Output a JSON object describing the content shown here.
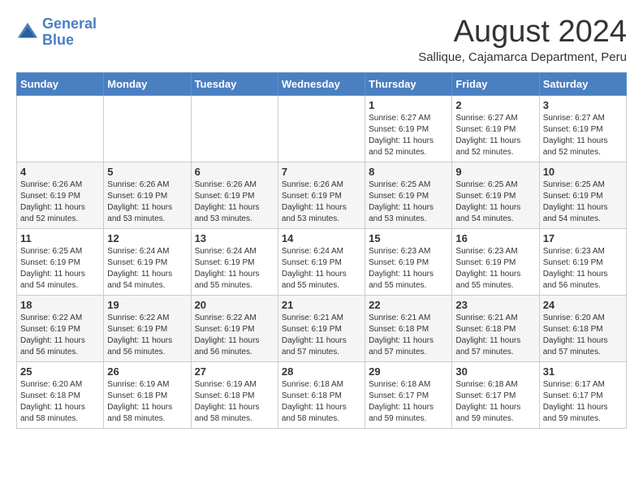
{
  "header": {
    "logo_line1": "General",
    "logo_line2": "Blue",
    "month_year": "August 2024",
    "location": "Sallique, Cajamarca Department, Peru"
  },
  "days_of_week": [
    "Sunday",
    "Monday",
    "Tuesday",
    "Wednesday",
    "Thursday",
    "Friday",
    "Saturday"
  ],
  "weeks": [
    [
      {
        "day": "",
        "info": ""
      },
      {
        "day": "",
        "info": ""
      },
      {
        "day": "",
        "info": ""
      },
      {
        "day": "",
        "info": ""
      },
      {
        "day": "1",
        "info": "Sunrise: 6:27 AM\nSunset: 6:19 PM\nDaylight: 11 hours\nand 52 minutes."
      },
      {
        "day": "2",
        "info": "Sunrise: 6:27 AM\nSunset: 6:19 PM\nDaylight: 11 hours\nand 52 minutes."
      },
      {
        "day": "3",
        "info": "Sunrise: 6:27 AM\nSunset: 6:19 PM\nDaylight: 11 hours\nand 52 minutes."
      }
    ],
    [
      {
        "day": "4",
        "info": "Sunrise: 6:26 AM\nSunset: 6:19 PM\nDaylight: 11 hours\nand 52 minutes."
      },
      {
        "day": "5",
        "info": "Sunrise: 6:26 AM\nSunset: 6:19 PM\nDaylight: 11 hours\nand 53 minutes."
      },
      {
        "day": "6",
        "info": "Sunrise: 6:26 AM\nSunset: 6:19 PM\nDaylight: 11 hours\nand 53 minutes."
      },
      {
        "day": "7",
        "info": "Sunrise: 6:26 AM\nSunset: 6:19 PM\nDaylight: 11 hours\nand 53 minutes."
      },
      {
        "day": "8",
        "info": "Sunrise: 6:25 AM\nSunset: 6:19 PM\nDaylight: 11 hours\nand 53 minutes."
      },
      {
        "day": "9",
        "info": "Sunrise: 6:25 AM\nSunset: 6:19 PM\nDaylight: 11 hours\nand 54 minutes."
      },
      {
        "day": "10",
        "info": "Sunrise: 6:25 AM\nSunset: 6:19 PM\nDaylight: 11 hours\nand 54 minutes."
      }
    ],
    [
      {
        "day": "11",
        "info": "Sunrise: 6:25 AM\nSunset: 6:19 PM\nDaylight: 11 hours\nand 54 minutes."
      },
      {
        "day": "12",
        "info": "Sunrise: 6:24 AM\nSunset: 6:19 PM\nDaylight: 11 hours\nand 54 minutes."
      },
      {
        "day": "13",
        "info": "Sunrise: 6:24 AM\nSunset: 6:19 PM\nDaylight: 11 hours\nand 55 minutes."
      },
      {
        "day": "14",
        "info": "Sunrise: 6:24 AM\nSunset: 6:19 PM\nDaylight: 11 hours\nand 55 minutes."
      },
      {
        "day": "15",
        "info": "Sunrise: 6:23 AM\nSunset: 6:19 PM\nDaylight: 11 hours\nand 55 minutes."
      },
      {
        "day": "16",
        "info": "Sunrise: 6:23 AM\nSunset: 6:19 PM\nDaylight: 11 hours\nand 55 minutes."
      },
      {
        "day": "17",
        "info": "Sunrise: 6:23 AM\nSunset: 6:19 PM\nDaylight: 11 hours\nand 56 minutes."
      }
    ],
    [
      {
        "day": "18",
        "info": "Sunrise: 6:22 AM\nSunset: 6:19 PM\nDaylight: 11 hours\nand 56 minutes."
      },
      {
        "day": "19",
        "info": "Sunrise: 6:22 AM\nSunset: 6:19 PM\nDaylight: 11 hours\nand 56 minutes."
      },
      {
        "day": "20",
        "info": "Sunrise: 6:22 AM\nSunset: 6:19 PM\nDaylight: 11 hours\nand 56 minutes."
      },
      {
        "day": "21",
        "info": "Sunrise: 6:21 AM\nSunset: 6:19 PM\nDaylight: 11 hours\nand 57 minutes."
      },
      {
        "day": "22",
        "info": "Sunrise: 6:21 AM\nSunset: 6:18 PM\nDaylight: 11 hours\nand 57 minutes."
      },
      {
        "day": "23",
        "info": "Sunrise: 6:21 AM\nSunset: 6:18 PM\nDaylight: 11 hours\nand 57 minutes."
      },
      {
        "day": "24",
        "info": "Sunrise: 6:20 AM\nSunset: 6:18 PM\nDaylight: 11 hours\nand 57 minutes."
      }
    ],
    [
      {
        "day": "25",
        "info": "Sunrise: 6:20 AM\nSunset: 6:18 PM\nDaylight: 11 hours\nand 58 minutes."
      },
      {
        "day": "26",
        "info": "Sunrise: 6:19 AM\nSunset: 6:18 PM\nDaylight: 11 hours\nand 58 minutes."
      },
      {
        "day": "27",
        "info": "Sunrise: 6:19 AM\nSunset: 6:18 PM\nDaylight: 11 hours\nand 58 minutes."
      },
      {
        "day": "28",
        "info": "Sunrise: 6:18 AM\nSunset: 6:18 PM\nDaylight: 11 hours\nand 58 minutes."
      },
      {
        "day": "29",
        "info": "Sunrise: 6:18 AM\nSunset: 6:17 PM\nDaylight: 11 hours\nand 59 minutes."
      },
      {
        "day": "30",
        "info": "Sunrise: 6:18 AM\nSunset: 6:17 PM\nDaylight: 11 hours\nand 59 minutes."
      },
      {
        "day": "31",
        "info": "Sunrise: 6:17 AM\nSunset: 6:17 PM\nDaylight: 11 hours\nand 59 minutes."
      }
    ]
  ]
}
